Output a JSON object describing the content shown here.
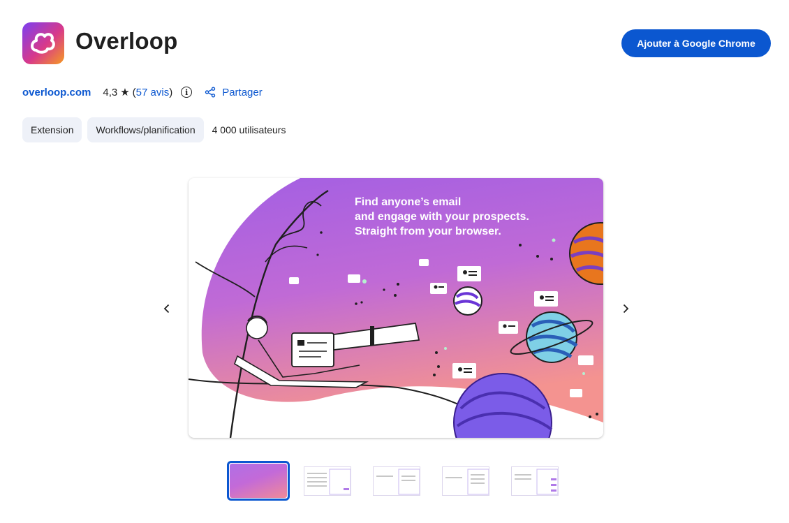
{
  "app": {
    "name": "Overloop",
    "icon": "overloop-logo-icon",
    "brand_gradient": [
      "#7b3ff2",
      "#d83a8a",
      "#f59a22"
    ]
  },
  "header": {
    "add_button_label": "Ajouter à Google Chrome",
    "accent_color": "#0b57d0"
  },
  "meta": {
    "site": "overloop.com",
    "rating": "4,3",
    "reviews_open": "(",
    "reviews_label": "57 avis",
    "reviews_close": ")",
    "share_label": "Partager"
  },
  "chips": [
    "Extension",
    "Workflows/planification"
  ],
  "users_label": "4 000 utilisateurs",
  "screenshot": {
    "headline": [
      "Find anyone’s email",
      "and engage with your prospects.",
      "Straight from your browser."
    ]
  },
  "thumbnails": {
    "count": 5,
    "active_index": 0
  },
  "icons": {
    "prev": "chevron-left-icon",
    "next": "chevron-right-icon",
    "info": "info-icon",
    "share": "share-icon",
    "star": "star-icon"
  }
}
